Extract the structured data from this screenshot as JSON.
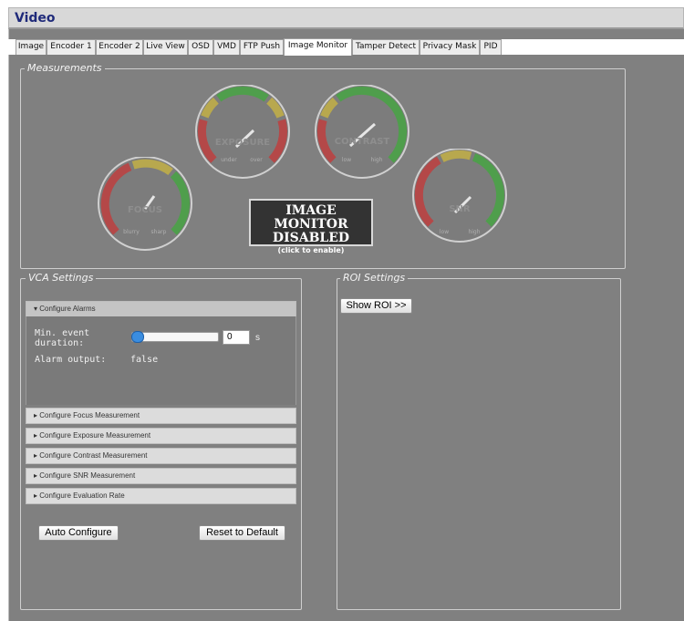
{
  "window": {
    "title": "Video"
  },
  "tabs": [
    {
      "label": "Image"
    },
    {
      "label": "Encoder 1"
    },
    {
      "label": "Encoder 2"
    },
    {
      "label": "Live View"
    },
    {
      "label": "OSD"
    },
    {
      "label": "VMD"
    },
    {
      "label": "FTP Push"
    },
    {
      "label": "Image Monitor",
      "active": true
    },
    {
      "label": "Tamper Detect"
    },
    {
      "label": "Privacy Mask"
    },
    {
      "label": "PID"
    }
  ],
  "measurements": {
    "legend": "Measurements",
    "gauges": [
      {
        "label": "FOCUS",
        "low": "blurry",
        "high": "sharp",
        "zones": [
          "red",
          "yellow",
          "green"
        ]
      },
      {
        "label": "EXPOSURE",
        "low": "under",
        "high": "over",
        "zones": [
          "red",
          "yellow",
          "green",
          "yellow",
          "red"
        ]
      },
      {
        "label": "CONTRAST",
        "low": "low",
        "high": "high",
        "zones": [
          "red",
          "yellow",
          "green"
        ]
      },
      {
        "label": "SNR",
        "low": "low",
        "high": "high",
        "zones": [
          "red",
          "yellow",
          "green"
        ]
      }
    ],
    "monitor": {
      "line1": "IMAGE MONITOR",
      "line2": "DISABLED",
      "line3": "(click to enable)"
    }
  },
  "vca": {
    "legend": "VCA Settings",
    "alarms_header": "Configure Alarms",
    "min_event_label_1": "Min. event",
    "min_event_label_2": "duration:",
    "min_event_value": "0",
    "min_event_unit": "s",
    "slider_fraction": 0.0,
    "alarm_output_label": "Alarm output:",
    "alarm_output_value": "false",
    "sections": [
      "Configure Focus Measurement",
      "Configure Exposure Measurement",
      "Configure Contrast Measurement",
      "Configure SNR Measurement",
      "Configure Evaluation Rate"
    ],
    "auto_configure": "Auto Configure",
    "reset_default": "Reset to Default"
  },
  "roi": {
    "legend": "ROI Settings",
    "show_roi": "Show ROI >>"
  },
  "colors": {
    "red": "#b44848",
    "yellow": "#b8a84e",
    "green": "#4f9e4c",
    "title_text": "#1f2a7a"
  }
}
